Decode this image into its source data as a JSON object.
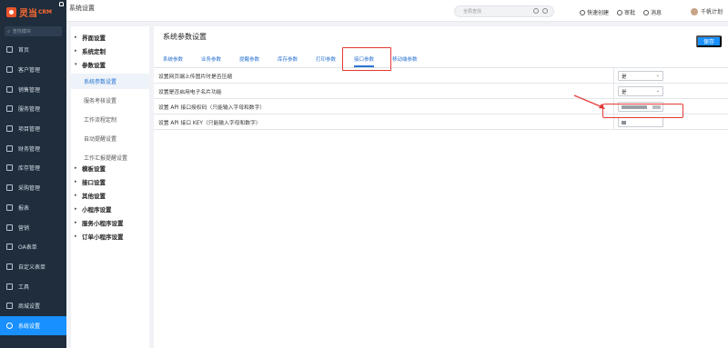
{
  "app": {
    "logo_text": "灵当",
    "logo_sub": "CRM",
    "search_placeholder": "查找模块"
  },
  "sidebar": {
    "items": [
      {
        "label": "首页"
      },
      {
        "label": "客户管理"
      },
      {
        "label": "销售管理"
      },
      {
        "label": "服务管理"
      },
      {
        "label": "项目管理"
      },
      {
        "label": "财务管理"
      },
      {
        "label": "库存管理"
      },
      {
        "label": "采购管理"
      },
      {
        "label": "报表"
      },
      {
        "label": "营销"
      },
      {
        "label": "OA表单"
      },
      {
        "label": "自定义表单"
      },
      {
        "label": "工具"
      },
      {
        "label": "商城设置"
      },
      {
        "label": "系统设置"
      }
    ]
  },
  "header": {
    "title": "系统设置",
    "global_search_placeholder": "全局查找",
    "quick_create": "快速创建",
    "approval": "审批",
    "messages": "消息",
    "user_name": "千帆计划"
  },
  "tree": {
    "groups": [
      {
        "label": "界面设置",
        "caret": "▸"
      },
      {
        "label": "系统定制",
        "caret": "▸"
      },
      {
        "label": "参数设置",
        "caret": "▾"
      },
      {
        "label": "模板设置",
        "caret": "▸"
      },
      {
        "label": "接口设置",
        "caret": "▸"
      },
      {
        "label": "其他设置",
        "caret": "▸"
      },
      {
        "label": "小程序设置",
        "caret": "▸"
      },
      {
        "label": "服务小程序设置",
        "caret": "▸"
      },
      {
        "label": "订单小程序设置",
        "caret": "▸"
      }
    ],
    "sub_items": [
      {
        "label": "系统参数设置"
      },
      {
        "label": "服务考核设置"
      },
      {
        "label": "工作流程定制"
      },
      {
        "label": "自动提醒设置"
      },
      {
        "label": "工作汇报提醒设置"
      }
    ]
  },
  "main": {
    "title": "系统参数设置",
    "save_label": "保存",
    "tabs": [
      {
        "label": "系统参数"
      },
      {
        "label": "业务参数"
      },
      {
        "label": "提醒参数"
      },
      {
        "label": "库存参数"
      },
      {
        "label": "打印参数"
      },
      {
        "label": "接口参数"
      },
      {
        "label": "移动端参数"
      }
    ],
    "active_tab": "接口参数",
    "rows": [
      {
        "label": "设置网页端上传图片时是否压缩",
        "value": "是"
      },
      {
        "label": "设置是否启用电子名片功能",
        "value": "是"
      },
      {
        "label": "设置 API 接口授权码（只能输入字母和数字）",
        "value": ""
      },
      {
        "label": "设置 API 接口 KEY（只能输入字母和数字）",
        "value": ""
      }
    ]
  },
  "colors": {
    "sidebar_bg": "#1f2d3d",
    "accent": "#1890ff",
    "highlight_red": "#e53935",
    "brand_orange": "#ff6a2f"
  }
}
